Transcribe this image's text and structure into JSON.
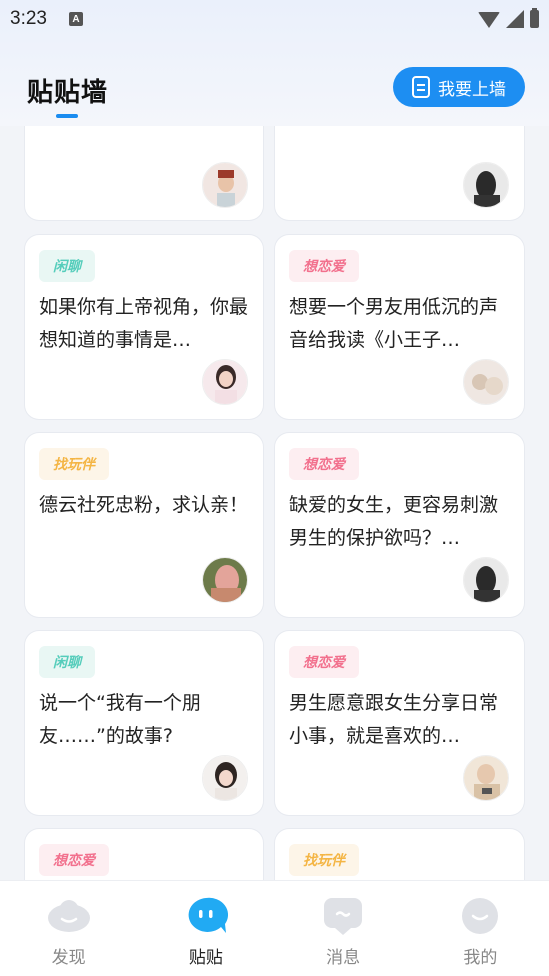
{
  "status": {
    "time": "3:23",
    "notif_glyph": "A"
  },
  "header": {
    "title": "贴贴墙",
    "post_button": "我要上墙"
  },
  "cards": [
    {
      "tag": "",
      "text": "",
      "partial": true
    },
    {
      "tag": "",
      "text": "",
      "partial": true
    },
    {
      "tag": "闲聊",
      "tag_type": "chat",
      "text": "如果你有上帝视角，你最想知道的事情是…"
    },
    {
      "tag": "想恋爱",
      "tag_type": "love",
      "text": "想要一个男友用低沉的声音给我读《小王子…"
    },
    {
      "tag": "找玩伴",
      "tag_type": "play",
      "text": "德云社死忠粉，求认亲！"
    },
    {
      "tag": "想恋爱",
      "tag_type": "love",
      "text": "缺爱的女生，更容易刺激男生的保护欲吗？…"
    },
    {
      "tag": "闲聊",
      "tag_type": "chat",
      "text": "说一个“我有一个朋友……”的故事?"
    },
    {
      "tag": "想恋爱",
      "tag_type": "love",
      "text": "男生愿意跟女生分享日常小事，就是喜欢的…"
    },
    {
      "tag": "想恋爱",
      "tag_type": "love",
      "text": ""
    },
    {
      "tag": "找玩伴",
      "tag_type": "play",
      "text": ""
    }
  ],
  "nav": [
    {
      "label": "发现",
      "icon": "discover-icon",
      "active": false
    },
    {
      "label": "贴贴",
      "icon": "tietie-icon",
      "active": true
    },
    {
      "label": "消息",
      "icon": "message-icon",
      "active": false
    },
    {
      "label": "我的",
      "icon": "profile-icon",
      "active": false
    }
  ],
  "colors": {
    "accent": "#1d8ef2",
    "chat_tag": "#55cdbb",
    "love_tag": "#f2708d",
    "play_tag": "#f4b544"
  }
}
